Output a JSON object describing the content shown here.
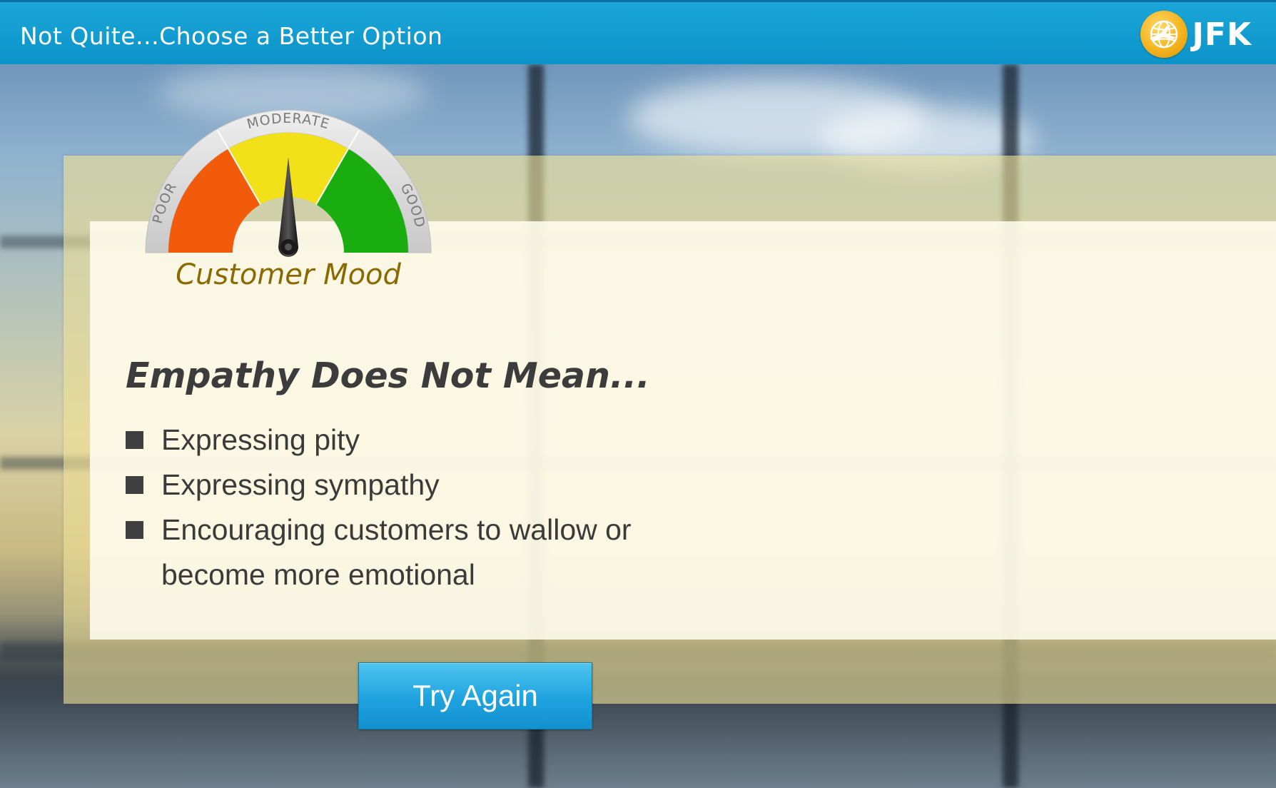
{
  "header": {
    "title": "Not Quite...Choose a Better Option",
    "brand": "JFK",
    "logo_icon": "globe-airplane-icon"
  },
  "gauge": {
    "label": "Customer Mood",
    "zones": [
      "POOR",
      "MODERATE",
      "GOOD"
    ],
    "level": 0.5,
    "colors": {
      "poor": "#f25b0a",
      "moderate": "#f2e018",
      "good": "#19ad0f",
      "rim": "#d9d9d9"
    }
  },
  "content": {
    "heading": "Empathy Does Not Mean...",
    "items": [
      "Expressing pity",
      "Expressing sympathy",
      "Encouraging customers to wallow or become more emotional"
    ]
  },
  "actions": {
    "try_again_label": "Try Again"
  },
  "colors": {
    "titlebar": "#0c93c9",
    "accent_button": "#1ea3df",
    "label_gold": "#8a6a00"
  }
}
